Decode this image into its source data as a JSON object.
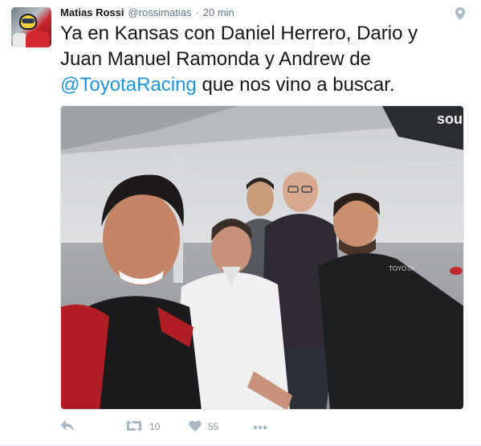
{
  "tweet": {
    "fullname": "Matias Rossi",
    "username": "@rossimatias",
    "separator": "·",
    "time": "20 min",
    "text_part1": "Ya en Kansas con Daniel Herrero, Dario y Juan Manuel Ramonda y Andrew de ",
    "mention": "@ToyotaRacing",
    "text_part2": " que nos vino a buscar.",
    "photo": {
      "sign_text": "sou",
      "shirt_text": "TOYOTA"
    }
  },
  "actions": {
    "retweet_count": "10",
    "like_count": "55"
  },
  "colors": {
    "link": "#1b95e0",
    "secondary_text": "#657786",
    "action_icon": "#aab8c2",
    "border": "#e1e8ed"
  }
}
